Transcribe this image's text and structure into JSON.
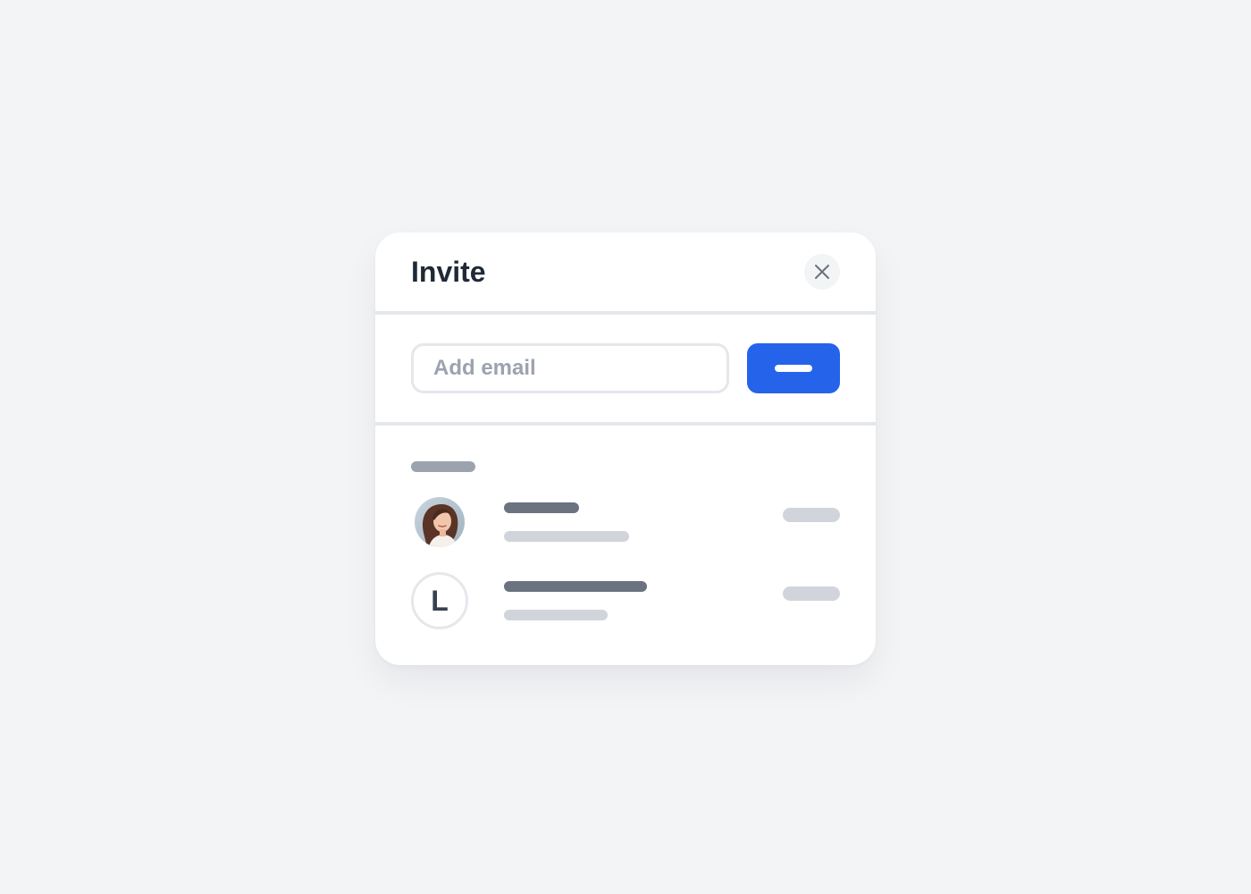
{
  "modal": {
    "title": "Invite",
    "close_icon": "close-icon"
  },
  "invite_form": {
    "email_placeholder": "Add email",
    "email_value": "",
    "submit_icon": "placeholder-bar"
  },
  "members": [
    {
      "avatar_type": "photo",
      "avatar_icon": "user-photo-avatar"
    },
    {
      "avatar_type": "initial",
      "initial": "L"
    }
  ],
  "colors": {
    "background": "#f3f4f6",
    "card": "#ffffff",
    "accent": "#2563eb",
    "title_text": "#1f2937",
    "divider": "#e5e7eb",
    "skeleton_dark": "#6b7280",
    "skeleton_mid": "#9ca3af",
    "skeleton_light": "#d1d5db"
  }
}
